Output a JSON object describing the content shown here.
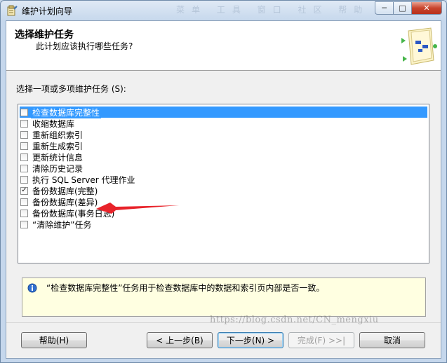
{
  "window": {
    "title": "维护计划向导",
    "ghost_menu": "菜单 工具 窗口 社区 帮助",
    "minimize_glyph": "─",
    "maximize_glyph": "□",
    "close_glyph": "✕"
  },
  "header": {
    "title": "选择维护任务",
    "subtitle": "此计划应该执行哪些任务?"
  },
  "task_section": {
    "label": "选择一项或多项维护任务 (S):"
  },
  "tasks": [
    {
      "label": "检查数据库完整性",
      "checked": false,
      "selected": true
    },
    {
      "label": "收缩数据库",
      "checked": false,
      "selected": false
    },
    {
      "label": "重新组织索引",
      "checked": false,
      "selected": false
    },
    {
      "label": "重新生成索引",
      "checked": false,
      "selected": false
    },
    {
      "label": "更新统计信息",
      "checked": false,
      "selected": false
    },
    {
      "label": "清除历史记录",
      "checked": false,
      "selected": false
    },
    {
      "label": "执行 SQL Server 代理作业",
      "checked": false,
      "selected": false
    },
    {
      "label": "备份数据库(完整)",
      "checked": true,
      "selected": false
    },
    {
      "label": "备份数据库(差异)",
      "checked": false,
      "selected": false
    },
    {
      "label": "备份数据库(事务日志)",
      "checked": false,
      "selected": false
    },
    {
      "label": "“清除维护”任务",
      "checked": false,
      "selected": false
    }
  ],
  "description": {
    "text": "“检查数据库完整性”任务用于检查数据库中的数据和索引页内部是否一致。"
  },
  "buttons": {
    "help": "帮助(H)",
    "back": "< 上一步(B)",
    "next": "下一步(N) >",
    "finish": "完成(F) >>|",
    "cancel": "取消"
  },
  "watermark": "https://blog.csdn.net/CN_mengxiu",
  "colors": {
    "selection": "#3399ff",
    "annotation_arrow": "#e8232a",
    "info_background": "#ffffe1"
  }
}
